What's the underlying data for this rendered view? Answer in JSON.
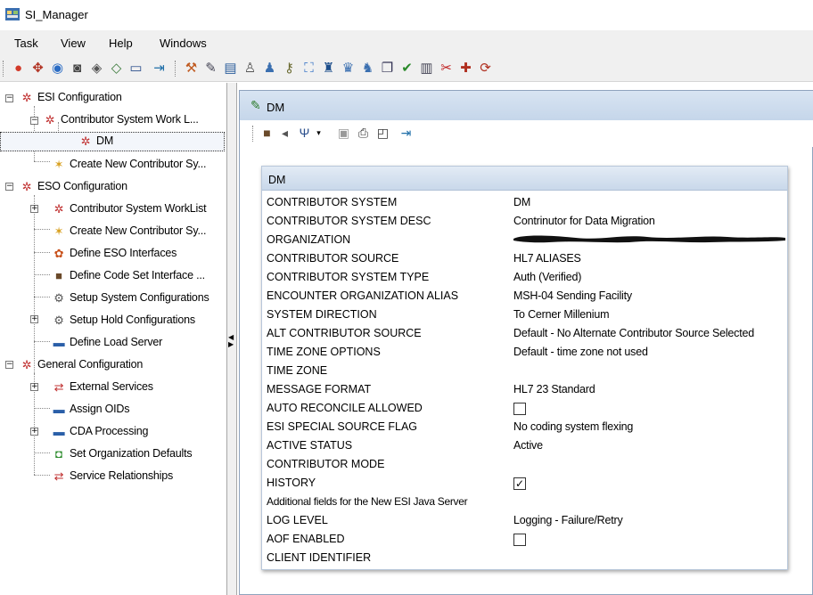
{
  "window": {
    "title": "SI_Manager"
  },
  "menu": [
    "Task",
    "View",
    "Help",
    "Windows"
  ],
  "toolbar_icons": [
    "refresh-icon",
    "target-icon",
    "globe-icon",
    "binoculars-icon",
    "search-icon",
    "find-icon",
    "monitor-icon",
    "exit-icon",
    "tools-icon",
    "edit-icon",
    "window-icon",
    "users-icon",
    "group-icon",
    "key-icon",
    "network-icon",
    "people-icon",
    "person-icon",
    "person-list-icon",
    "copy-icon",
    "check-icon",
    "document-icon",
    "cut-icon",
    "new-icon",
    "sync-icon"
  ],
  "tree": {
    "nodes": [
      {
        "label": "ESI Configuration"
      },
      {
        "label": "Contributor System Work L..."
      },
      {
        "label": "DM"
      },
      {
        "label": "Create New Contributor Sy..."
      },
      {
        "label": "ESO Configuration"
      },
      {
        "label": "Contributor System WorkList"
      },
      {
        "label": "Create New Contributor Sy..."
      },
      {
        "label": "Define ESO Interfaces"
      },
      {
        "label": "Define Code Set Interface ..."
      },
      {
        "label": "Setup System Configurations"
      },
      {
        "label": "Setup Hold Configurations"
      },
      {
        "label": "Define Load Server"
      },
      {
        "label": "General Configuration"
      },
      {
        "label": "External Services"
      },
      {
        "label": "Assign OIDs"
      },
      {
        "label": "CDA Processing"
      },
      {
        "label": "Set Organization Defaults"
      },
      {
        "label": "Service Relationships"
      }
    ]
  },
  "document": {
    "title": "DM",
    "toolbar_icons": [
      "cube-icon",
      "arrow-icon",
      "filter-icon",
      "save-icon",
      "print-icon",
      "preview-icon",
      "exit-icon"
    ]
  },
  "panel": {
    "title": "DM",
    "rows": [
      {
        "label": "CONTRIBUTOR SYSTEM",
        "value": "DM"
      },
      {
        "label": "CONTRIBUTOR SYSTEM DESC",
        "value": "Contrinutor for Data Migration"
      },
      {
        "label": "ORGANIZATION",
        "value": ""
      },
      {
        "label": "CONTRIBUTOR SOURCE",
        "value": "HL7  ALIASES"
      },
      {
        "label": "CONTRIBUTOR SYSTEM TYPE",
        "value": "Auth (Verified)"
      },
      {
        "label": "ENCOUNTER ORGANIZATION ALIAS",
        "value": "MSH-04 Sending Facility"
      },
      {
        "label": "SYSTEM DIRECTION",
        "value": "To Cerner Millenium"
      },
      {
        "label": "ALT CONTRIBUTOR SOURCE",
        "value": "Default - No Alternate Contributor Source Selected"
      },
      {
        "label": "TIME ZONE OPTIONS",
        "value": "Default - time zone not used"
      },
      {
        "label": "TIME ZONE",
        "value": ""
      },
      {
        "label": "MESSAGE FORMAT",
        "value": "HL7 23 Standard"
      },
      {
        "label": "AUTO RECONCILE ALLOWED",
        "value": ""
      },
      {
        "label": "ESI SPECIAL SOURCE FLAG",
        "value": "No coding system flexing"
      },
      {
        "label": "ACTIVE STATUS",
        "value": "Active"
      },
      {
        "label": "CONTRIBUTOR MODE",
        "value": ""
      },
      {
        "label": "HISTORY",
        "value": ""
      },
      {
        "label": "Additional fields for the New ESI Java Server",
        "value": ""
      },
      {
        "label": "LOG LEVEL",
        "value": "Logging - Failure/Retry"
      },
      {
        "label": "AOF ENABLED",
        "value": ""
      },
      {
        "label": "CLIENT IDENTIFIER",
        "value": ""
      }
    ],
    "checkboxes": {
      "auto_reconcile": false,
      "history": true,
      "aof_enabled": false
    },
    "check_glyph": "✓"
  }
}
